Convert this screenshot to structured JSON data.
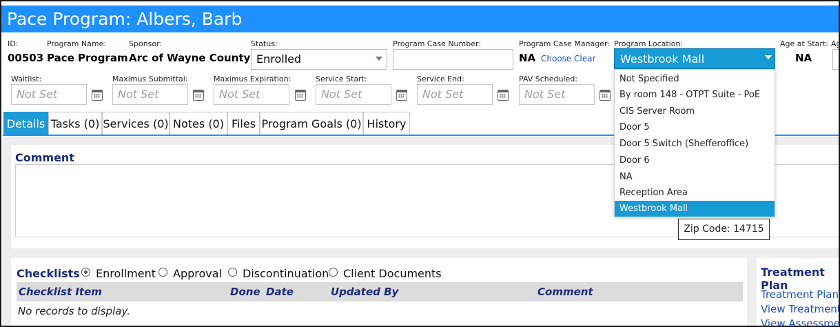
{
  "title": "Pace Program: Albers, Barb",
  "fields": {
    "id": {
      "label": "ID:",
      "value": "00503"
    },
    "program_name": {
      "label": "Program Name:",
      "value": "Pace Program"
    },
    "sponsor": {
      "label": "Sponsor:",
      "value": "Arc of Wayne County"
    },
    "status": {
      "label": "Status:",
      "value": "Enrolled"
    },
    "case_number": {
      "label": "Program Case Number:",
      "value": ""
    },
    "case_manager": {
      "label": "Program Case Manager:",
      "value": "NA",
      "choose": "Choose",
      "clear": "Clear"
    },
    "location": {
      "label": "Program Location:",
      "value": "Westbrook Mall"
    },
    "age_at_start": {
      "label": "Age at Start:",
      "value": "NA"
    },
    "age_cut": {
      "label": "Ag"
    }
  },
  "dates": [
    {
      "label": "Waitlist:",
      "placeholder": "Not Set"
    },
    {
      "label": "Maximus Submittal:",
      "placeholder": "Not Set"
    },
    {
      "label": "Maximus Expiration:",
      "placeholder": "Not Set"
    },
    {
      "label": "Service Start:",
      "placeholder": "Not Set"
    },
    {
      "label": "Service End:",
      "placeholder": "Not Set"
    },
    {
      "label": "PAV Scheduled:",
      "placeholder": "Not Set"
    }
  ],
  "tabs": [
    {
      "label": "Details"
    },
    {
      "label": "Tasks (0)"
    },
    {
      "label": "Services (0)"
    },
    {
      "label": "Notes (0)"
    },
    {
      "label": "Files"
    },
    {
      "label": "Program Goals (0)"
    },
    {
      "label": "History"
    }
  ],
  "comment": {
    "heading": "Comment"
  },
  "checklists": {
    "heading": "Checklists",
    "options": [
      "Enrollment",
      "Approval",
      "Discontinuation",
      "Client Documents"
    ],
    "selected": "Enrollment",
    "columns": [
      "Checklist Item",
      "Done",
      "Date",
      "Updated By",
      "Comment"
    ],
    "empty": "No records to display."
  },
  "treatment": {
    "heading": "Treatment Plan",
    "links": [
      "Treatment Plan S",
      "View Treatment P",
      "View Assessment"
    ]
  },
  "location_dropdown": {
    "items": [
      "Not Specified",
      "By room 148 - OTPT Suite - PoE",
      "CIS Server Room",
      "Door 5",
      "Door 5 Switch (Shefferoffice)",
      "Door 6",
      "NA",
      "Reception Area",
      "Westbrook Mall"
    ],
    "selected_index": 8
  },
  "tooltip": "Zip Code: 14715",
  "colors": {
    "accent": "#1e90ff",
    "selected": "#169bd5",
    "heading": "#1b2a7a"
  }
}
